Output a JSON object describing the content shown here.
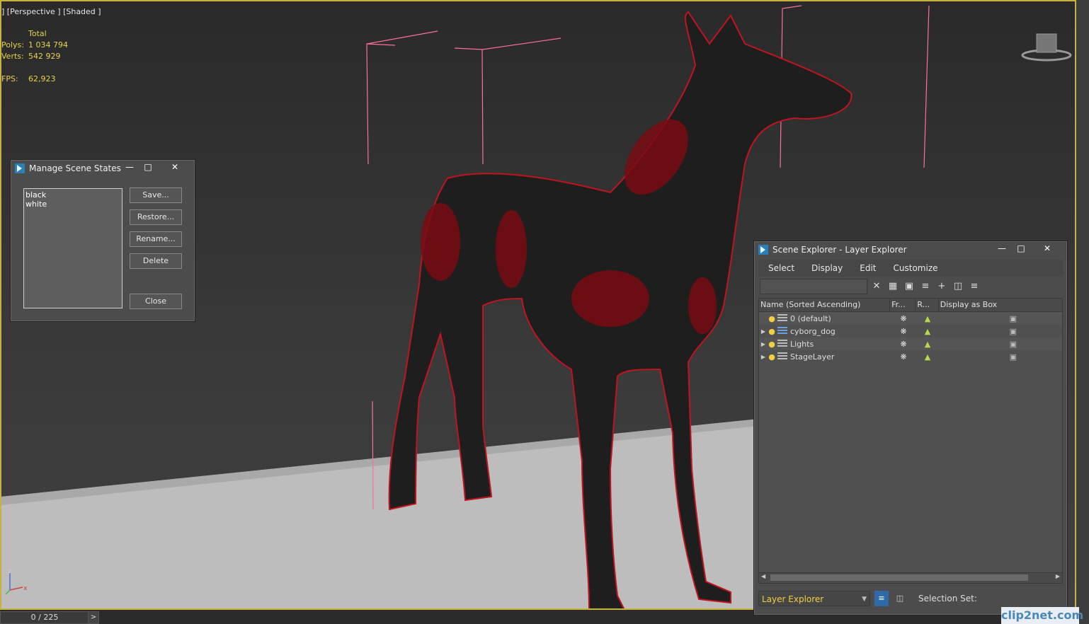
{
  "viewport": {
    "label": "] [Perspective ] [Shaded ]",
    "stats": {
      "header": "Total",
      "rows": [
        {
          "key": "Polys:",
          "value": "1 034 794"
        },
        {
          "key": "Verts:",
          "value": "542 929"
        },
        {
          "key": "FPS:",
          "value": "62,923"
        }
      ]
    },
    "axis": {
      "z": "z",
      "x": "x"
    }
  },
  "scene_states": {
    "title": "Manage Scene States",
    "items": [
      "black",
      "white"
    ],
    "buttons": {
      "save": "Save...",
      "restore": "Restore...",
      "rename": "Rename...",
      "delete": "Delete",
      "close": "Close"
    }
  },
  "scene_explorer": {
    "title": "Scene Explorer - Layer Explorer",
    "menu": [
      "Select",
      "Display",
      "Edit",
      "Customize"
    ],
    "columns": [
      "Name (Sorted Ascending)",
      "Fr...",
      "R...",
      "Display as Box"
    ],
    "rows": [
      {
        "name": "0 (default)",
        "expandable": false,
        "icon": "layer",
        "active": false
      },
      {
        "name": "cyborg_dog",
        "expandable": true,
        "icon": "layer-blue",
        "active": true
      },
      {
        "name": "Lights",
        "expandable": true,
        "icon": "layer",
        "active": false
      },
      {
        "name": "StageLayer",
        "expandable": true,
        "icon": "layer",
        "active": false
      }
    ],
    "explorer_type": "Layer Explorer",
    "selection_set_label": "Selection Set:"
  },
  "timeline": {
    "frame": "0 / 225",
    "next": ">"
  },
  "watermark": "clip2net.com"
}
